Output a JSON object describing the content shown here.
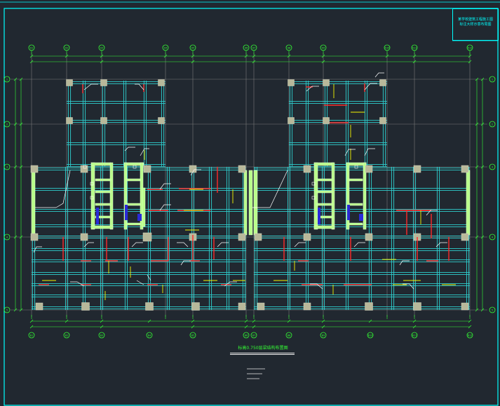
{
  "drawing": {
    "title_block": {
      "line1": "某学校建筑工程施工图",
      "line2": "标注大样示意布局图"
    },
    "caption": "标高0.750层梁结构布置图",
    "notes": [
      "——",
      "——",
      "——"
    ]
  },
  "colors": {
    "background": "#212830",
    "frame": "#00ffff",
    "beam": "#2fd1d1",
    "wall": "#b8ff8a",
    "column": "#b8b89a",
    "axis_line": "#7a7a7a",
    "dimension": "#34ff34",
    "rebar": "#ff2a2a",
    "annotation_yellow": "#f5f500",
    "leader": "#ffffff",
    "opening": "#2a2ad8"
  },
  "axes": {
    "top": [
      "A1",
      "A2",
      "A3",
      "A4",
      "A5",
      "A6",
      "A7",
      "A8",
      "A9",
      "A10",
      "A11",
      "A12"
    ],
    "bottom": [
      "B1",
      "B2",
      "B3",
      "B4",
      "B5",
      "B6",
      "B7",
      "B8",
      "B9",
      "B10",
      "B11",
      "B12"
    ],
    "left": [
      "1",
      "2",
      "3",
      "4",
      "5"
    ],
    "right": [
      "1",
      "2",
      "3",
      "4",
      "5"
    ]
  }
}
